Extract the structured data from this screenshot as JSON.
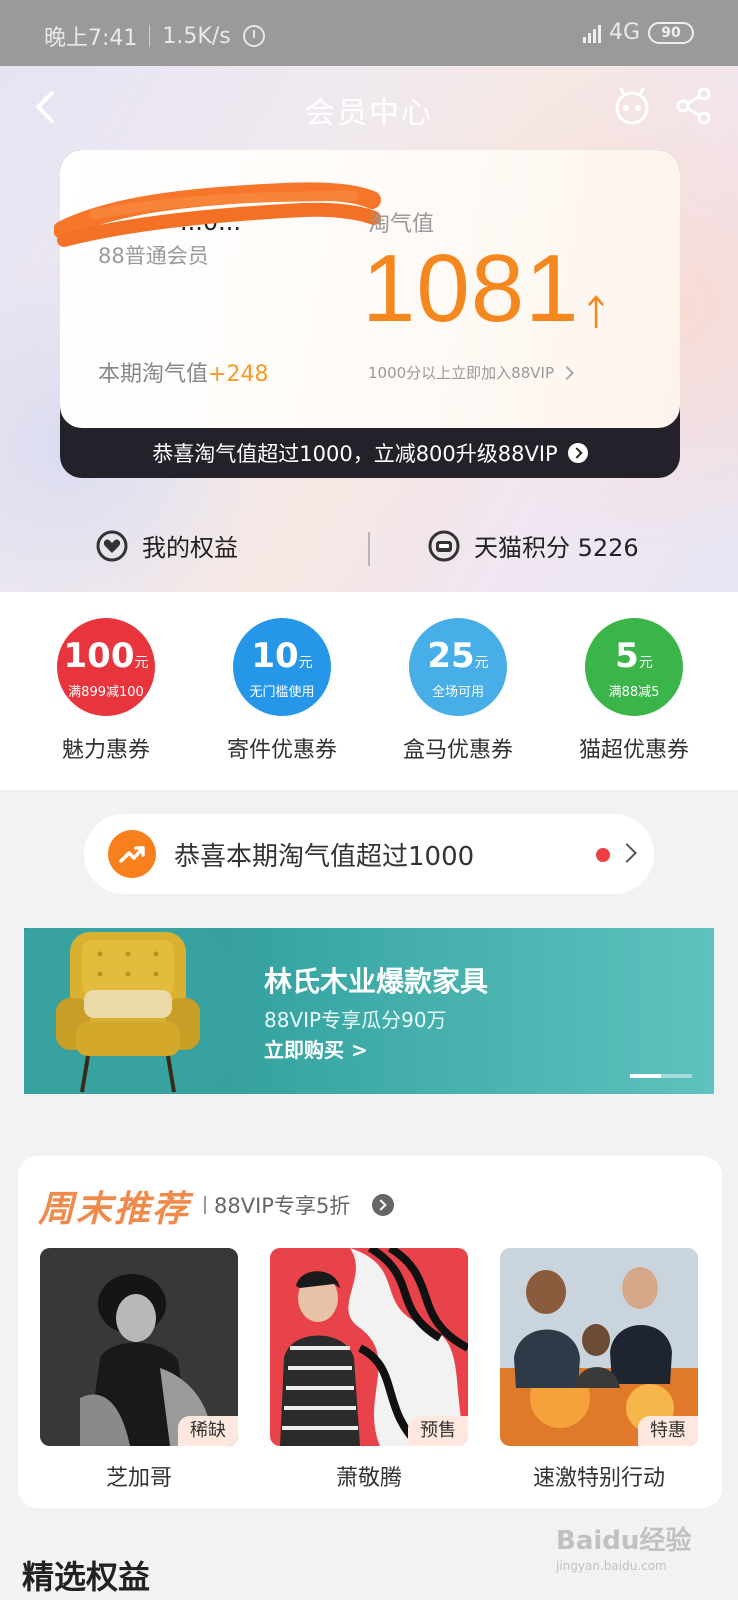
{
  "status_bar": {
    "time": "晚上7:41",
    "speed": "1.5K/s",
    "network": "4G",
    "battery": "90"
  },
  "nav": {
    "title": "会员中心"
  },
  "member_card": {
    "username": "...0...",
    "level": "88普通会员",
    "period_label": "本期淘气值",
    "period_value": "+248",
    "taoqi_label": "淘气值",
    "taoqi_value": "1081",
    "join_text": "1000分以上立即加入88VIP",
    "strip_text": "恭喜淘气值超过1000，立减800升级88VIP"
  },
  "rights": {
    "my_rights": "我的权益",
    "tmall_points": "天猫积分 5226"
  },
  "coupons": [
    {
      "amount": "100",
      "unit": "元",
      "condition": "满899减100",
      "label": "魅力惠券",
      "color": "#e8343d"
    },
    {
      "amount": "10",
      "unit": "元",
      "condition": "无门槛使用",
      "label": "寄件优惠券",
      "color": "#2596e8"
    },
    {
      "amount": "25",
      "unit": "元",
      "condition": "全场可用",
      "label": "盒马优惠券",
      "color": "#48aee8"
    },
    {
      "amount": "5",
      "unit": "元",
      "condition": "满88减5",
      "label": "猫超优惠券",
      "color": "#3bb54a"
    }
  ],
  "notice": {
    "text": "恭喜本期淘气值超过1000"
  },
  "banner": {
    "title": "林氏木业爆款家具",
    "subtitle": "88VIP专享瓜分90万",
    "cta": "立即购买 >",
    "progress": 0.5
  },
  "weekend": {
    "title": "周末推荐",
    "subtitle": "88VIP专享5折",
    "items": [
      {
        "name": "芝加哥",
        "tag": "稀缺"
      },
      {
        "name": "萧敬腾",
        "tag": "预售"
      },
      {
        "name": "速激特别行动",
        "tag": "特惠"
      }
    ]
  },
  "section": {
    "title": "精选权益"
  },
  "watermark": {
    "brand": "Baidu经验",
    "url": "jingyan.baidu.com"
  },
  "colors": {
    "accent_orange": "#f5871f",
    "red_dot": "#f03e45"
  }
}
